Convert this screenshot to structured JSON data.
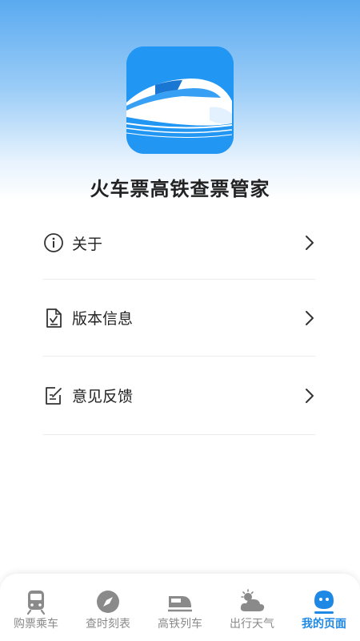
{
  "app": {
    "name": "火车票高铁查票管家",
    "logo_icon": "high-speed-train-logo"
  },
  "menu": {
    "items": [
      {
        "label": "关于",
        "icon": "info-circle-icon"
      },
      {
        "label": "版本信息",
        "icon": "document-check-icon"
      },
      {
        "label": "意见反馈",
        "icon": "edit-note-icon"
      }
    ]
  },
  "tabbar": {
    "tabs": [
      {
        "label": "购票乘车",
        "icon": "train-front-icon",
        "active": false
      },
      {
        "label": "查时刻表",
        "icon": "compass-icon",
        "active": false
      },
      {
        "label": "高铁列车",
        "icon": "bullet-train-icon",
        "active": false
      },
      {
        "label": "出行天气",
        "icon": "weather-icon",
        "active": false
      },
      {
        "label": "我的页面",
        "icon": "user-face-icon",
        "active": true
      }
    ],
    "active_color": "#1e88e5",
    "inactive_color": "#8a8a8a"
  }
}
